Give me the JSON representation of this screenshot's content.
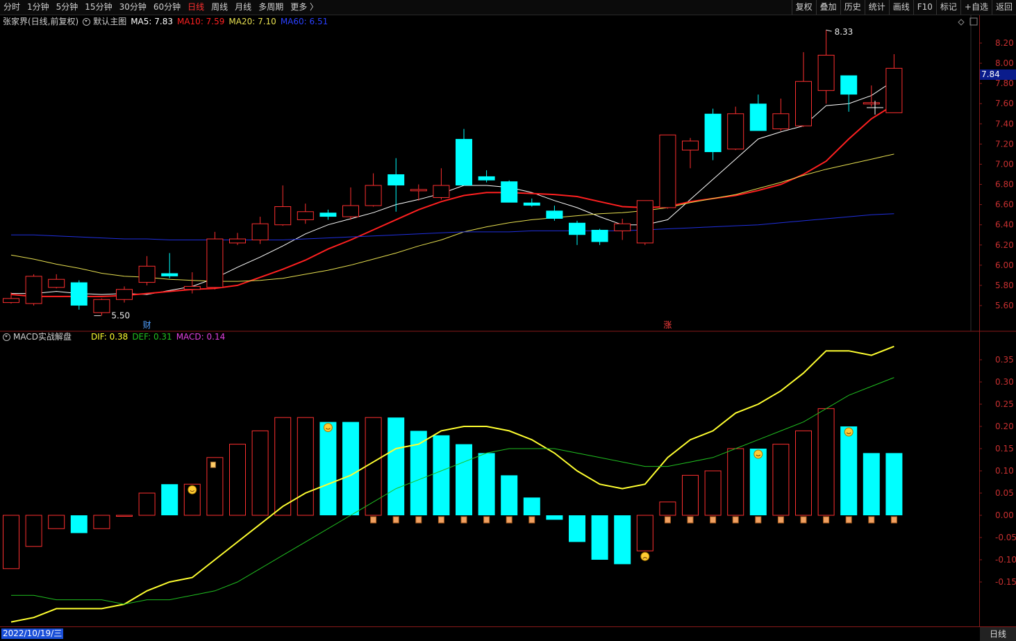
{
  "toolbar": {
    "periods": [
      "分时",
      "1分钟",
      "5分钟",
      "15分钟",
      "30分钟",
      "60分钟",
      "日线",
      "周线",
      "月线",
      "多周期",
      "更多 〉"
    ],
    "active_period": "日线",
    "tools": [
      "复权",
      "叠加",
      "历史",
      "统计",
      "画线",
      "F10",
      "标记",
      "+自选",
      "返回"
    ]
  },
  "main_header": {
    "stock": "张家界(日线,前复权)",
    "template": "默认主图",
    "ma5": "MA5: 7.83",
    "ma10": "MA10: 7.59",
    "ma20": "MA20: 7.10",
    "ma60": "MA60: 6.51"
  },
  "macd_header": {
    "name": "MACD实战解盘",
    "dif": "DIF: 0.38",
    "def": "DEF: 0.31",
    "macd": "MACD: 0.14"
  },
  "colors": {
    "ma5": "#ffffff",
    "ma10": "#ff2020",
    "ma20": "#e8e050",
    "ma60": "#2030e0",
    "up": "#ff3030",
    "down": "#00ffff",
    "dif": "#ffff30",
    "def": "#20c020",
    "grid": "#8a1a1a"
  },
  "price_axis": [
    "8.20",
    "8.00",
    "7.80",
    "7.60",
    "7.40",
    "7.20",
    "7.00",
    "6.80",
    "6.60",
    "6.40",
    "6.20",
    "6.00",
    "5.80",
    "5.60"
  ],
  "macd_axis": [
    "0.35",
    "0.30",
    "0.25",
    "0.20",
    "0.15",
    "0.10",
    "0.05",
    "0.00",
    "-0.05",
    "-0.10",
    "-0.15"
  ],
  "current_price": "7.84",
  "high_label": "8.33",
  "low_label": "5.50",
  "event_marks": [
    "财",
    "涨"
  ],
  "chart_data": [
    {
      "type": "candlestick",
      "title": "",
      "ylim": [
        5.5,
        8.35
      ],
      "candles": [
        {
          "o": 5.63,
          "h": 5.73,
          "l": 5.62,
          "c": 5.67
        },
        {
          "o": 5.62,
          "h": 5.91,
          "l": 5.6,
          "c": 5.89
        },
        {
          "o": 5.78,
          "h": 5.91,
          "l": 5.77,
          "c": 5.86
        },
        {
          "o": 5.83,
          "h": 5.85,
          "l": 5.56,
          "c": 5.6
        },
        {
          "o": 5.53,
          "h": 5.67,
          "l": 5.5,
          "c": 5.66
        },
        {
          "o": 5.66,
          "h": 5.79,
          "l": 5.63,
          "c": 5.76
        },
        {
          "o": 5.83,
          "h": 6.09,
          "l": 5.8,
          "c": 5.99
        },
        {
          "o": 5.92,
          "h": 6.12,
          "l": 5.87,
          "c": 5.89
        },
        {
          "o": 5.76,
          "h": 5.93,
          "l": 5.72,
          "c": 5.79
        },
        {
          "o": 5.78,
          "h": 6.33,
          "l": 5.76,
          "c": 6.26
        },
        {
          "o": 6.22,
          "h": 6.32,
          "l": 6.2,
          "c": 6.26
        },
        {
          "o": 6.25,
          "h": 6.48,
          "l": 6.21,
          "c": 6.41
        },
        {
          "o": 6.4,
          "h": 6.79,
          "l": 6.39,
          "c": 6.58
        },
        {
          "o": 6.45,
          "h": 6.61,
          "l": 6.41,
          "c": 6.53
        },
        {
          "o": 6.52,
          "h": 6.55,
          "l": 6.45,
          "c": 6.48
        },
        {
          "o": 6.48,
          "h": 6.77,
          "l": 6.45,
          "c": 6.59
        },
        {
          "o": 6.59,
          "h": 6.91,
          "l": 6.58,
          "c": 6.79
        },
        {
          "o": 6.9,
          "h": 7.06,
          "l": 6.53,
          "c": 6.79
        },
        {
          "o": 6.75,
          "h": 6.8,
          "l": 6.64,
          "c": 6.75
        },
        {
          "o": 6.67,
          "h": 6.96,
          "l": 6.65,
          "c": 6.79
        },
        {
          "o": 7.25,
          "h": 7.35,
          "l": 6.8,
          "c": 6.79
        },
        {
          "o": 6.88,
          "h": 6.94,
          "l": 6.82,
          "c": 6.84
        },
        {
          "o": 6.83,
          "h": 6.84,
          "l": 6.63,
          "c": 6.62
        },
        {
          "o": 6.62,
          "h": 6.66,
          "l": 6.58,
          "c": 6.59
        },
        {
          "o": 6.54,
          "h": 6.59,
          "l": 6.44,
          "c": 6.46
        },
        {
          "o": 6.42,
          "h": 6.44,
          "l": 6.2,
          "c": 6.3
        },
        {
          "o": 6.35,
          "h": 6.36,
          "l": 6.2,
          "c": 6.23
        },
        {
          "o": 6.34,
          "h": 6.46,
          "l": 6.25,
          "c": 6.41
        },
        {
          "o": 6.22,
          "h": 6.64,
          "l": 6.2,
          "c": 6.64
        },
        {
          "o": 6.57,
          "h": 7.29,
          "l": 6.56,
          "c": 7.29
        },
        {
          "o": 7.14,
          "h": 7.26,
          "l": 6.96,
          "c": 7.23
        },
        {
          "o": 7.5,
          "h": 7.55,
          "l": 7.04,
          "c": 7.12
        },
        {
          "o": 7.15,
          "h": 7.57,
          "l": 7.14,
          "c": 7.5
        },
        {
          "o": 7.6,
          "h": 7.69,
          "l": 7.33,
          "c": 7.33
        },
        {
          "o": 7.35,
          "h": 7.65,
          "l": 7.33,
          "c": 7.5
        },
        {
          "o": 7.38,
          "h": 8.11,
          "l": 7.37,
          "c": 7.82
        },
        {
          "o": 7.73,
          "h": 8.33,
          "l": 7.6,
          "c": 8.08
        },
        {
          "o": 7.88,
          "h": 7.88,
          "l": 7.52,
          "c": 7.69
        },
        {
          "o": 7.6,
          "h": 7.78,
          "l": 7.57,
          "c": 7.61
        },
        {
          "o": 7.51,
          "h": 8.09,
          "l": 7.51,
          "c": 7.95
        }
      ],
      "series": [
        {
          "name": "MA5",
          "values": [
            5.72,
            5.72,
            5.74,
            5.72,
            5.71,
            5.72,
            5.71,
            5.75,
            5.79,
            5.87,
            5.98,
            6.08,
            6.19,
            6.31,
            6.4,
            6.46,
            6.52,
            6.6,
            6.65,
            6.71,
            6.79,
            6.79,
            6.77,
            6.72,
            6.64,
            6.57,
            6.48,
            6.4,
            6.4,
            6.45,
            6.65,
            6.85,
            7.05,
            7.25,
            7.32,
            7.38,
            7.58,
            7.6,
            7.68,
            7.83
          ]
        },
        {
          "name": "MA10",
          "values": [
            5.71,
            5.69,
            5.69,
            5.69,
            5.69,
            5.7,
            5.72,
            5.74,
            5.76,
            5.77,
            5.8,
            5.88,
            5.96,
            6.05,
            6.16,
            6.25,
            6.35,
            6.45,
            6.55,
            6.63,
            6.69,
            6.72,
            6.72,
            6.71,
            6.7,
            6.68,
            6.63,
            6.58,
            6.57,
            6.58,
            6.63,
            6.66,
            6.69,
            6.74,
            6.8,
            6.9,
            7.03,
            7.25,
            7.45,
            7.59
          ]
        },
        {
          "name": "MA20",
          "values": [
            6.1,
            6.06,
            6.01,
            5.97,
            5.92,
            5.89,
            5.88,
            5.86,
            5.85,
            5.84,
            5.84,
            5.85,
            5.87,
            5.91,
            5.95,
            6.0,
            6.06,
            6.12,
            6.19,
            6.25,
            6.33,
            6.38,
            6.42,
            6.45,
            6.47,
            6.49,
            6.51,
            6.52,
            6.54,
            6.57,
            6.62,
            6.66,
            6.7,
            6.76,
            6.82,
            6.89,
            6.95,
            7.0,
            7.05,
            7.1
          ]
        },
        {
          "name": "MA60",
          "values": [
            6.3,
            6.3,
            6.29,
            6.28,
            6.27,
            6.26,
            6.26,
            6.25,
            6.25,
            6.25,
            6.25,
            6.25,
            6.25,
            6.26,
            6.27,
            6.28,
            6.29,
            6.3,
            6.31,
            6.32,
            6.33,
            6.33,
            6.33,
            6.34,
            6.34,
            6.34,
            6.34,
            6.34,
            6.35,
            6.36,
            6.37,
            6.38,
            6.39,
            6.4,
            6.42,
            6.44,
            6.46,
            6.48,
            6.5,
            6.51
          ]
        }
      ]
    },
    {
      "type": "bar",
      "title": "",
      "ylim": [
        -0.24,
        0.4
      ],
      "values": [
        -0.12,
        -0.07,
        -0.03,
        -0.04,
        -0.03,
        0.0,
        0.05,
        0.07,
        0.07,
        0.13,
        0.16,
        0.19,
        0.22,
        0.22,
        0.21,
        0.21,
        0.22,
        0.22,
        0.19,
        0.18,
        0.16,
        0.14,
        0.09,
        0.04,
        -0.01,
        -0.06,
        -0.1,
        -0.11,
        -0.08,
        0.03,
        0.09,
        0.1,
        0.15,
        0.15,
        0.16,
        0.19,
        0.24,
        0.2,
        0.14,
        0.14
      ],
      "series": [
        {
          "name": "DIF",
          "values": [
            -0.24,
            -0.23,
            -0.21,
            -0.21,
            -0.21,
            -0.2,
            -0.17,
            -0.15,
            -0.14,
            -0.1,
            -0.06,
            -0.02,
            0.02,
            0.05,
            0.07,
            0.09,
            0.12,
            0.15,
            0.16,
            0.19,
            0.2,
            0.2,
            0.19,
            0.17,
            0.14,
            0.1,
            0.07,
            0.06,
            0.07,
            0.13,
            0.17,
            0.19,
            0.23,
            0.25,
            0.28,
            0.32,
            0.37,
            0.37,
            0.36,
            0.38
          ]
        },
        {
          "name": "DEF",
          "values": [
            -0.18,
            -0.18,
            -0.19,
            -0.19,
            -0.19,
            -0.2,
            -0.19,
            -0.19,
            -0.18,
            -0.17,
            -0.15,
            -0.12,
            -0.09,
            -0.06,
            -0.03,
            0.0,
            0.03,
            0.06,
            0.08,
            0.1,
            0.12,
            0.14,
            0.15,
            0.15,
            0.15,
            0.14,
            0.13,
            0.12,
            0.11,
            0.11,
            0.12,
            0.13,
            0.15,
            0.17,
            0.19,
            0.21,
            0.24,
            0.27,
            0.29,
            0.31
          ]
        }
      ]
    }
  ]
}
